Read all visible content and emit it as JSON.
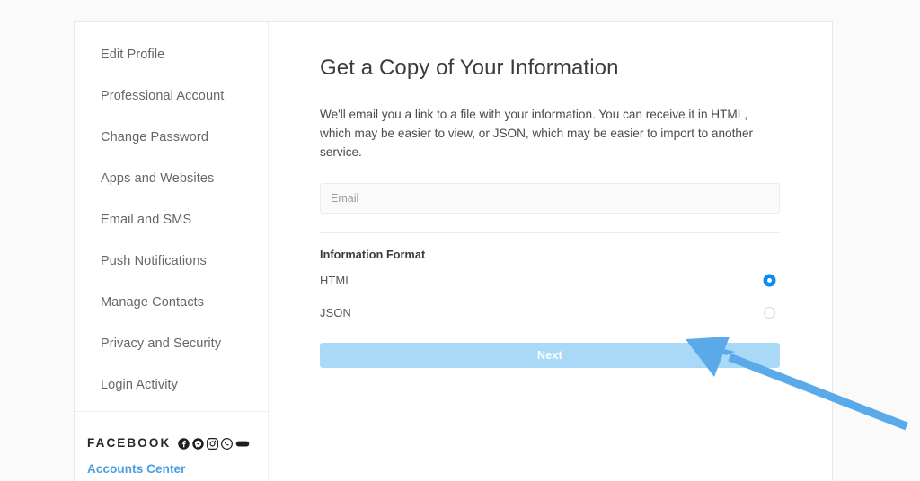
{
  "sidebar": {
    "items": [
      {
        "label": "Edit Profile",
        "name": "sidebar-item-edit-profile"
      },
      {
        "label": "Professional Account",
        "name": "sidebar-item-professional-account"
      },
      {
        "label": "Change Password",
        "name": "sidebar-item-change-password"
      },
      {
        "label": "Apps and Websites",
        "name": "sidebar-item-apps-and-websites"
      },
      {
        "label": "Email and SMS",
        "name": "sidebar-item-email-and-sms"
      },
      {
        "label": "Push Notifications",
        "name": "sidebar-item-push-notifications"
      },
      {
        "label": "Manage Contacts",
        "name": "sidebar-item-manage-contacts"
      },
      {
        "label": "Privacy and Security",
        "name": "sidebar-item-privacy-and-security"
      },
      {
        "label": "Login Activity",
        "name": "sidebar-item-login-activity"
      }
    ],
    "footer": {
      "wordmark": "FACEBOOK",
      "accounts_center_link": "Accounts Center",
      "link_color": "#4a9fe0",
      "social_icons": [
        "facebook-icon",
        "messenger-icon",
        "instagram-icon",
        "whatsapp-icon",
        "portal-icon"
      ]
    }
  },
  "main": {
    "title": "Get a Copy of Your Information",
    "description": "We'll email you a link to a file with your information. You can receive it in HTML, which may be easier to view, or JSON, which may be easier to import to another service.",
    "email": {
      "value": "",
      "placeholder": "Email"
    },
    "format_section": {
      "label": "Information Format",
      "selected": "HTML",
      "options": [
        {
          "label": "HTML",
          "selected": true
        },
        {
          "label": "JSON",
          "selected": false
        }
      ]
    },
    "next_button": {
      "label": "Next",
      "color": "#aad9f8",
      "text_color": "#ffffff",
      "enabled": false
    }
  },
  "annotation": {
    "arrow_color": "#5aaaea",
    "points_to": "Next"
  }
}
